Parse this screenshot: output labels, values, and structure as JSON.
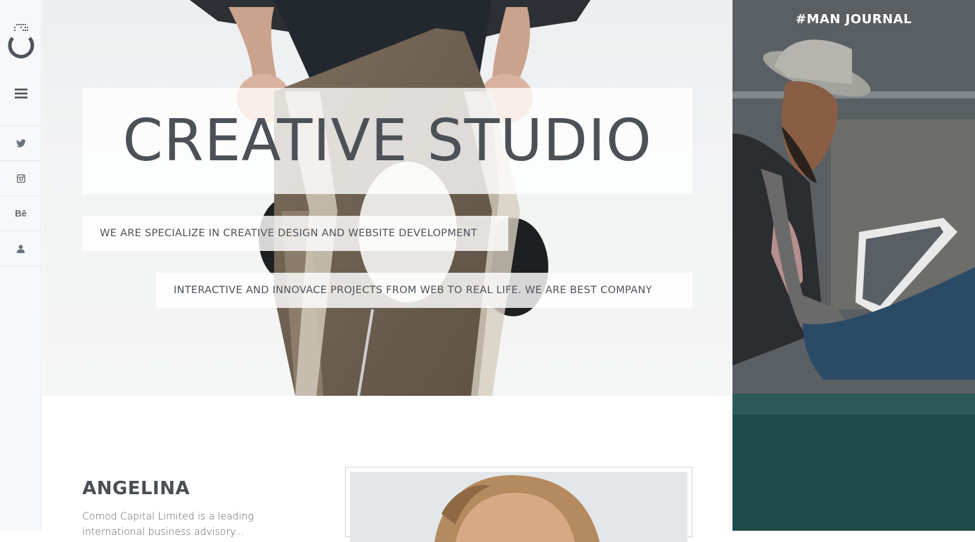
{
  "sidebar": {
    "logo_icon": "studio-logo-icon",
    "menu_icon": "hamburger-menu-icon",
    "social": [
      {
        "name": "twitter",
        "icon": "twitter-icon"
      },
      {
        "name": "instagram",
        "icon": "instagram-icon"
      },
      {
        "name": "behance",
        "icon": "behance-icon",
        "label": "Bē"
      },
      {
        "name": "account",
        "icon": "user-icon"
      }
    ]
  },
  "hero": {
    "title": "CREATIVE STUDIO",
    "tagline_1": "WE ARE SPECIALIZE IN CREATIVE DESIGN AND WEBSITE DEVELOPMENT",
    "tagline_2": "INTERACTIVE AND INNOVACE PROJECTS FROM WEB TO REAL LIFE. WE ARE BEST COMPANY"
  },
  "about": {
    "name": "ANGELINA",
    "text": "Comod Capital Limited is a leading international business advisory..."
  },
  "journal": {
    "title": "#MAN JOURNAL"
  },
  "colors": {
    "text_dark": "#4b5157",
    "sidebar_bg": "#f6f8f9",
    "overlay_white": "#ffffff"
  }
}
